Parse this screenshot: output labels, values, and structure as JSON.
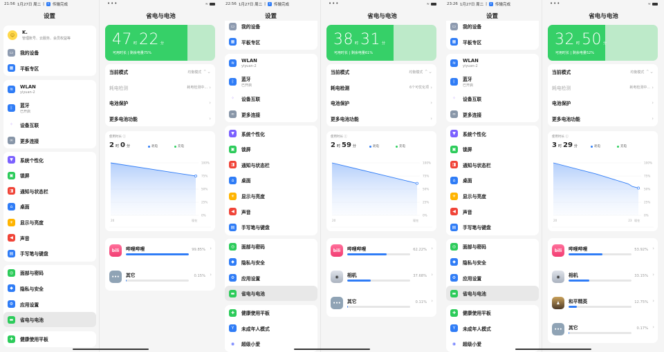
{
  "colors": {
    "green": "#36d068",
    "green_light": "#bdeac9",
    "blue": "#2f7cf6",
    "chart_green": "#2fd05f"
  },
  "sidebar": {
    "title": "设置",
    "selected": "省电与电池",
    "groups": [
      [
        {
          "label": "K.",
          "sub": "管理账号、云服务、会员权益等",
          "icon": "avatar-icon",
          "color": "#ffd84a",
          "kind": "profile"
        },
        {
          "label": "我的设备",
          "icon": "tablet-icon",
          "color": "#8e9bb0"
        },
        {
          "label": "平板专区",
          "icon": "grid-icon",
          "color": "#2f7cf6"
        }
      ],
      [
        {
          "label": "WLAN",
          "sub": "yiyuan-2",
          "icon": "wifi-icon",
          "color": "#2f7cf6"
        },
        {
          "label": "蓝牙",
          "sub": "已开启",
          "icon": "bluetooth-icon",
          "color": "#2f7cf6"
        },
        {
          "label": "设备互联",
          "icon": "device-connect-icon",
          "color": "#ffffff"
        },
        {
          "label": "更多连接",
          "icon": "link-icon",
          "color": "#8896a8"
        }
      ],
      [
        {
          "label": "系统个性化",
          "icon": "brush-icon",
          "color": "#7b61ff"
        },
        {
          "label": "锁屏",
          "icon": "lock-icon",
          "color": "#2ccb5a"
        },
        {
          "label": "通知与状态栏",
          "icon": "notification-icon",
          "color": "#f04438"
        },
        {
          "label": "桌面",
          "icon": "home-icon",
          "color": "#2f7cf6"
        },
        {
          "label": "显示与亮度",
          "icon": "sun-icon",
          "color": "#ffb400"
        },
        {
          "label": "声音",
          "icon": "speaker-icon",
          "color": "#f04438"
        },
        {
          "label": "手写笔与键盘",
          "icon": "keyboard-icon",
          "color": "#2f7cf6"
        }
      ],
      [
        {
          "label": "面部与密码",
          "icon": "fingerprint-icon",
          "color": "#2ccb5a"
        },
        {
          "label": "隐私与安全",
          "icon": "shield-icon",
          "color": "#2f7cf6"
        },
        {
          "label": "应用设置",
          "icon": "gear-icon",
          "color": "#2f7cf6"
        },
        {
          "label": "省电与电池",
          "icon": "battery-icon",
          "color": "#2ccb5a"
        }
      ],
      [
        {
          "label": "健康使用平板",
          "icon": "health-icon",
          "color": "#2ccb5a"
        },
        {
          "label": "未成年人模式",
          "icon": "sprout-icon",
          "color": "#2f7cf6"
        },
        {
          "label": "超级小爱",
          "icon": "xiaoai-icon",
          "color": "#ffffff"
        }
      ]
    ]
  },
  "main_title": "省电与电池",
  "battery_sub_prefix": "可用时长 | 剩余电量",
  "unit_hour": "时",
  "unit_min": "分",
  "usage_label": "使用时长 ⓘ",
  "legend": {
    "drain": "耗电",
    "charge": "充电"
  },
  "y_ticks": [
    "100%",
    "75%",
    "50%",
    "25%",
    "0%"
  ],
  "screens": [
    {
      "status": {
        "time": "21:56",
        "date": "1月27日 周二",
        "notice": "传输完成"
      },
      "battery": {
        "hours": "47",
        "minutes": "22",
        "percent": 75
      },
      "rows": [
        {
          "label": "当前模式",
          "value": "均衡模式",
          "chev": "⌃⌄",
          "dim": false
        },
        {
          "label": "耗电检测",
          "value": "耗电检测中...",
          "chev": "›",
          "dim": true
        },
        {
          "label": "电池保护",
          "value": "",
          "chev": "›",
          "dim": false
        },
        {
          "label": "更多电池功能",
          "value": "",
          "chev": "›",
          "dim": false
        }
      ],
      "usage": {
        "hours": "2",
        "minutes": "0"
      },
      "chart_data": {
        "type": "area",
        "x": [
          0,
          1
        ],
        "y": [
          100,
          75
        ],
        "x_ticks": [
          {
            "at": 0,
            "label": "20"
          },
          {
            "at": 1,
            "label": "现在"
          }
        ],
        "ylim": [
          0,
          100
        ]
      },
      "apps": [
        {
          "name": "哔哩哔哩",
          "pct": "99.85%",
          "value": 99.85,
          "icon": "bilibili-icon"
        },
        {
          "name": "其它",
          "pct": "0.15%",
          "value": 0.15,
          "icon": "more-icon"
        }
      ]
    },
    {
      "status": {
        "time": "22:56",
        "date": "1月27日 周二",
        "notice": "传输完成"
      },
      "battery": {
        "hours": "38",
        "minutes": "31",
        "percent": 61
      },
      "rows": [
        {
          "label": "当前模式",
          "value": "均衡模式",
          "chev": "⌃⌄",
          "dim": false
        },
        {
          "label": "耗电检测",
          "value": "6个可优化项",
          "chev": "›",
          "dim": false
        },
        {
          "label": "电池保护",
          "value": "",
          "chev": "›",
          "dim": false
        },
        {
          "label": "更多电池功能",
          "value": "",
          "chev": "›",
          "dim": false
        }
      ],
      "usage": {
        "hours": "2",
        "minutes": "59"
      },
      "chart_data": {
        "type": "area",
        "x": [
          0,
          1
        ],
        "y": [
          100,
          61
        ],
        "x_ticks": [
          {
            "at": 0,
            "label": "20"
          },
          {
            "at": 1,
            "label": "现在"
          }
        ],
        "ylim": [
          0,
          100
        ]
      },
      "apps": [
        {
          "name": "哔哩哔哩",
          "pct": "62.22%",
          "value": 62.22,
          "icon": "bilibili-icon"
        },
        {
          "name": "相机",
          "pct": "37.68%",
          "value": 37.68,
          "icon": "camera-icon"
        },
        {
          "name": "其它",
          "pct": "0.11%",
          "value": 0.11,
          "icon": "more-icon"
        }
      ]
    },
    {
      "status": {
        "time": "23:26",
        "date": "1月27日 周二",
        "notice": "传输完成"
      },
      "battery": {
        "hours": "32",
        "minutes": "50",
        "percent": 52
      },
      "rows": [
        {
          "label": "当前模式",
          "value": "均衡模式",
          "chev": "⌃⌄",
          "dim": false
        },
        {
          "label": "耗电检测",
          "value": "耗电检测中...",
          "chev": "›",
          "dim": true
        },
        {
          "label": "电池保护",
          "value": "",
          "chev": "›",
          "dim": false
        },
        {
          "label": "更多电池功能",
          "value": "",
          "chev": "›",
          "dim": false
        }
      ],
      "usage": {
        "hours": "3",
        "minutes": "29"
      },
      "chart_data": {
        "type": "area",
        "x": [
          0,
          0.5,
          0.88,
          0.93,
          1
        ],
        "y": [
          100,
          79,
          60,
          55,
          52
        ],
        "x_ticks": [
          {
            "at": 0,
            "label": "20"
          },
          {
            "at": 0.88,
            "label": "23"
          },
          {
            "at": 1,
            "label": "现在"
          }
        ],
        "ylim": [
          0,
          100
        ]
      },
      "apps": [
        {
          "name": "哔哩哔哩",
          "pct": "53.92%",
          "value": 53.92,
          "icon": "bilibili-icon"
        },
        {
          "name": "相机",
          "pct": "33.15%",
          "value": 33.15,
          "icon": "camera-icon"
        },
        {
          "name": "和平精英",
          "pct": "12.75%",
          "value": 12.75,
          "icon": "game-icon"
        },
        {
          "name": "其它",
          "pct": "0.17%",
          "value": 0.17,
          "icon": "more-icon"
        }
      ]
    }
  ]
}
